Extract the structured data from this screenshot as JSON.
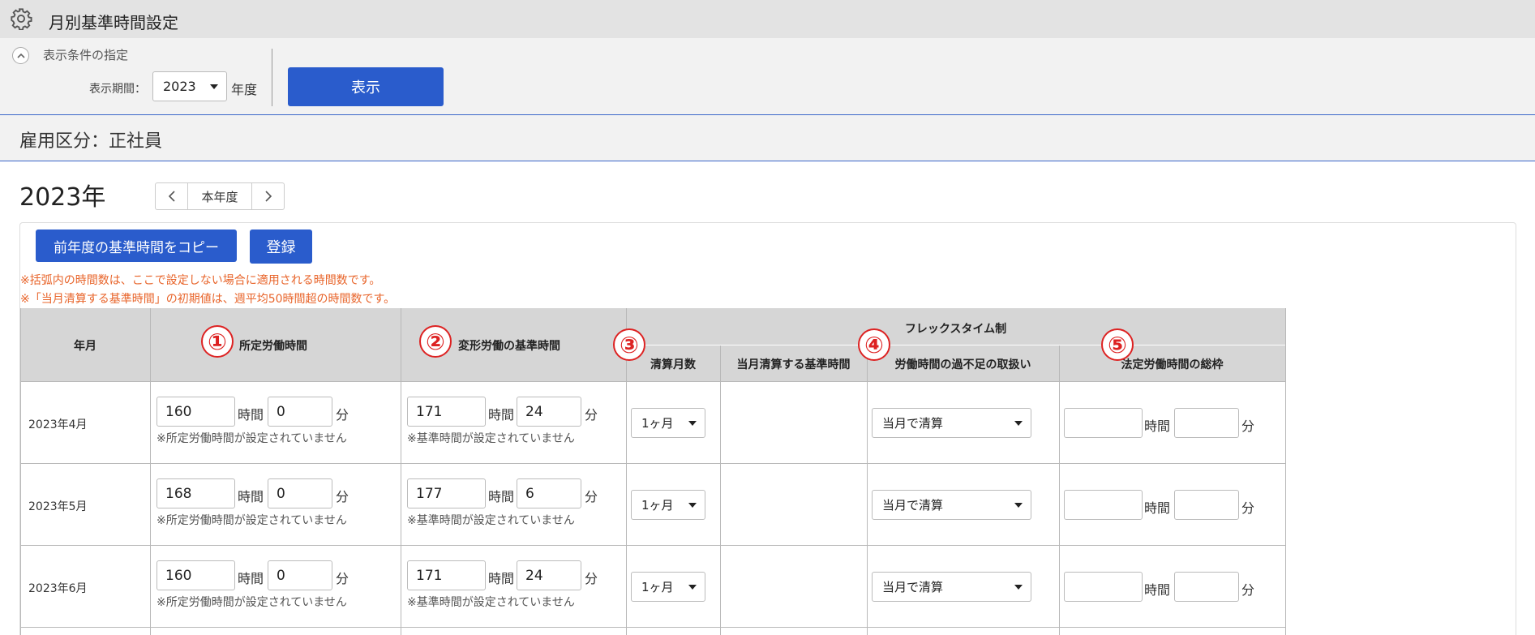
{
  "header": {
    "title": "月別基準時間設定",
    "icon": "gear-icon"
  },
  "conditions": {
    "label": "表示条件の指定",
    "period_label": "表示期間：",
    "year_value": "2023",
    "year_unit": "年度",
    "show_button": "表示"
  },
  "section": {
    "title": "雇用区分：正社員"
  },
  "year": {
    "title": "2023年",
    "current_button": "本年度"
  },
  "actions": {
    "copy_button": "前年度の基準時間をコピー",
    "register_button": "登録"
  },
  "notes": [
    "※括弧内の時間数は、ここで設定しない場合に適用される時間数です。",
    "※「当月清算する基準時間」の初期値は、週平均50時間超の時間数です。"
  ],
  "table": {
    "headers": {
      "month": "年月",
      "prescribed": "所定労働時間",
      "variable": "変形労働の基準時間",
      "flex": "フレックスタイム制",
      "settle_months": "清算月数",
      "monthly_base": "当月清算する基準時間",
      "handling": "労働時間の過不足の取扱い",
      "legal_limit": "法定労働時間の総枠"
    },
    "markers": [
      "①",
      "②",
      "③",
      "④",
      "⑤"
    ],
    "units": {
      "hour": "時間",
      "minute": "分"
    },
    "rows": [
      {
        "month": "2023年4月",
        "p_h": "160",
        "p_m": "0",
        "p_note": "※所定労働時間が設定されていません",
        "v_h": "171",
        "v_m": "24",
        "v_note": "※基準時間が設定されていません",
        "settle": "1ヶ月",
        "handling": "当月で清算",
        "legal_h": "",
        "legal_m": ""
      },
      {
        "month": "2023年5月",
        "p_h": "168",
        "p_m": "0",
        "p_note": "※所定労働時間が設定されていません",
        "v_h": "177",
        "v_m": "6",
        "v_note": "※基準時間が設定されていません",
        "settle": "1ヶ月",
        "handling": "当月で清算",
        "legal_h": "",
        "legal_m": ""
      },
      {
        "month": "2023年6月",
        "p_h": "160",
        "p_m": "0",
        "p_note": "※所定労働時間が設定されていません",
        "v_h": "171",
        "v_m": "24",
        "v_note": "※基準時間が設定されていません",
        "settle": "1ヶ月",
        "handling": "当月で清算",
        "legal_h": "",
        "legal_m": ""
      }
    ]
  }
}
